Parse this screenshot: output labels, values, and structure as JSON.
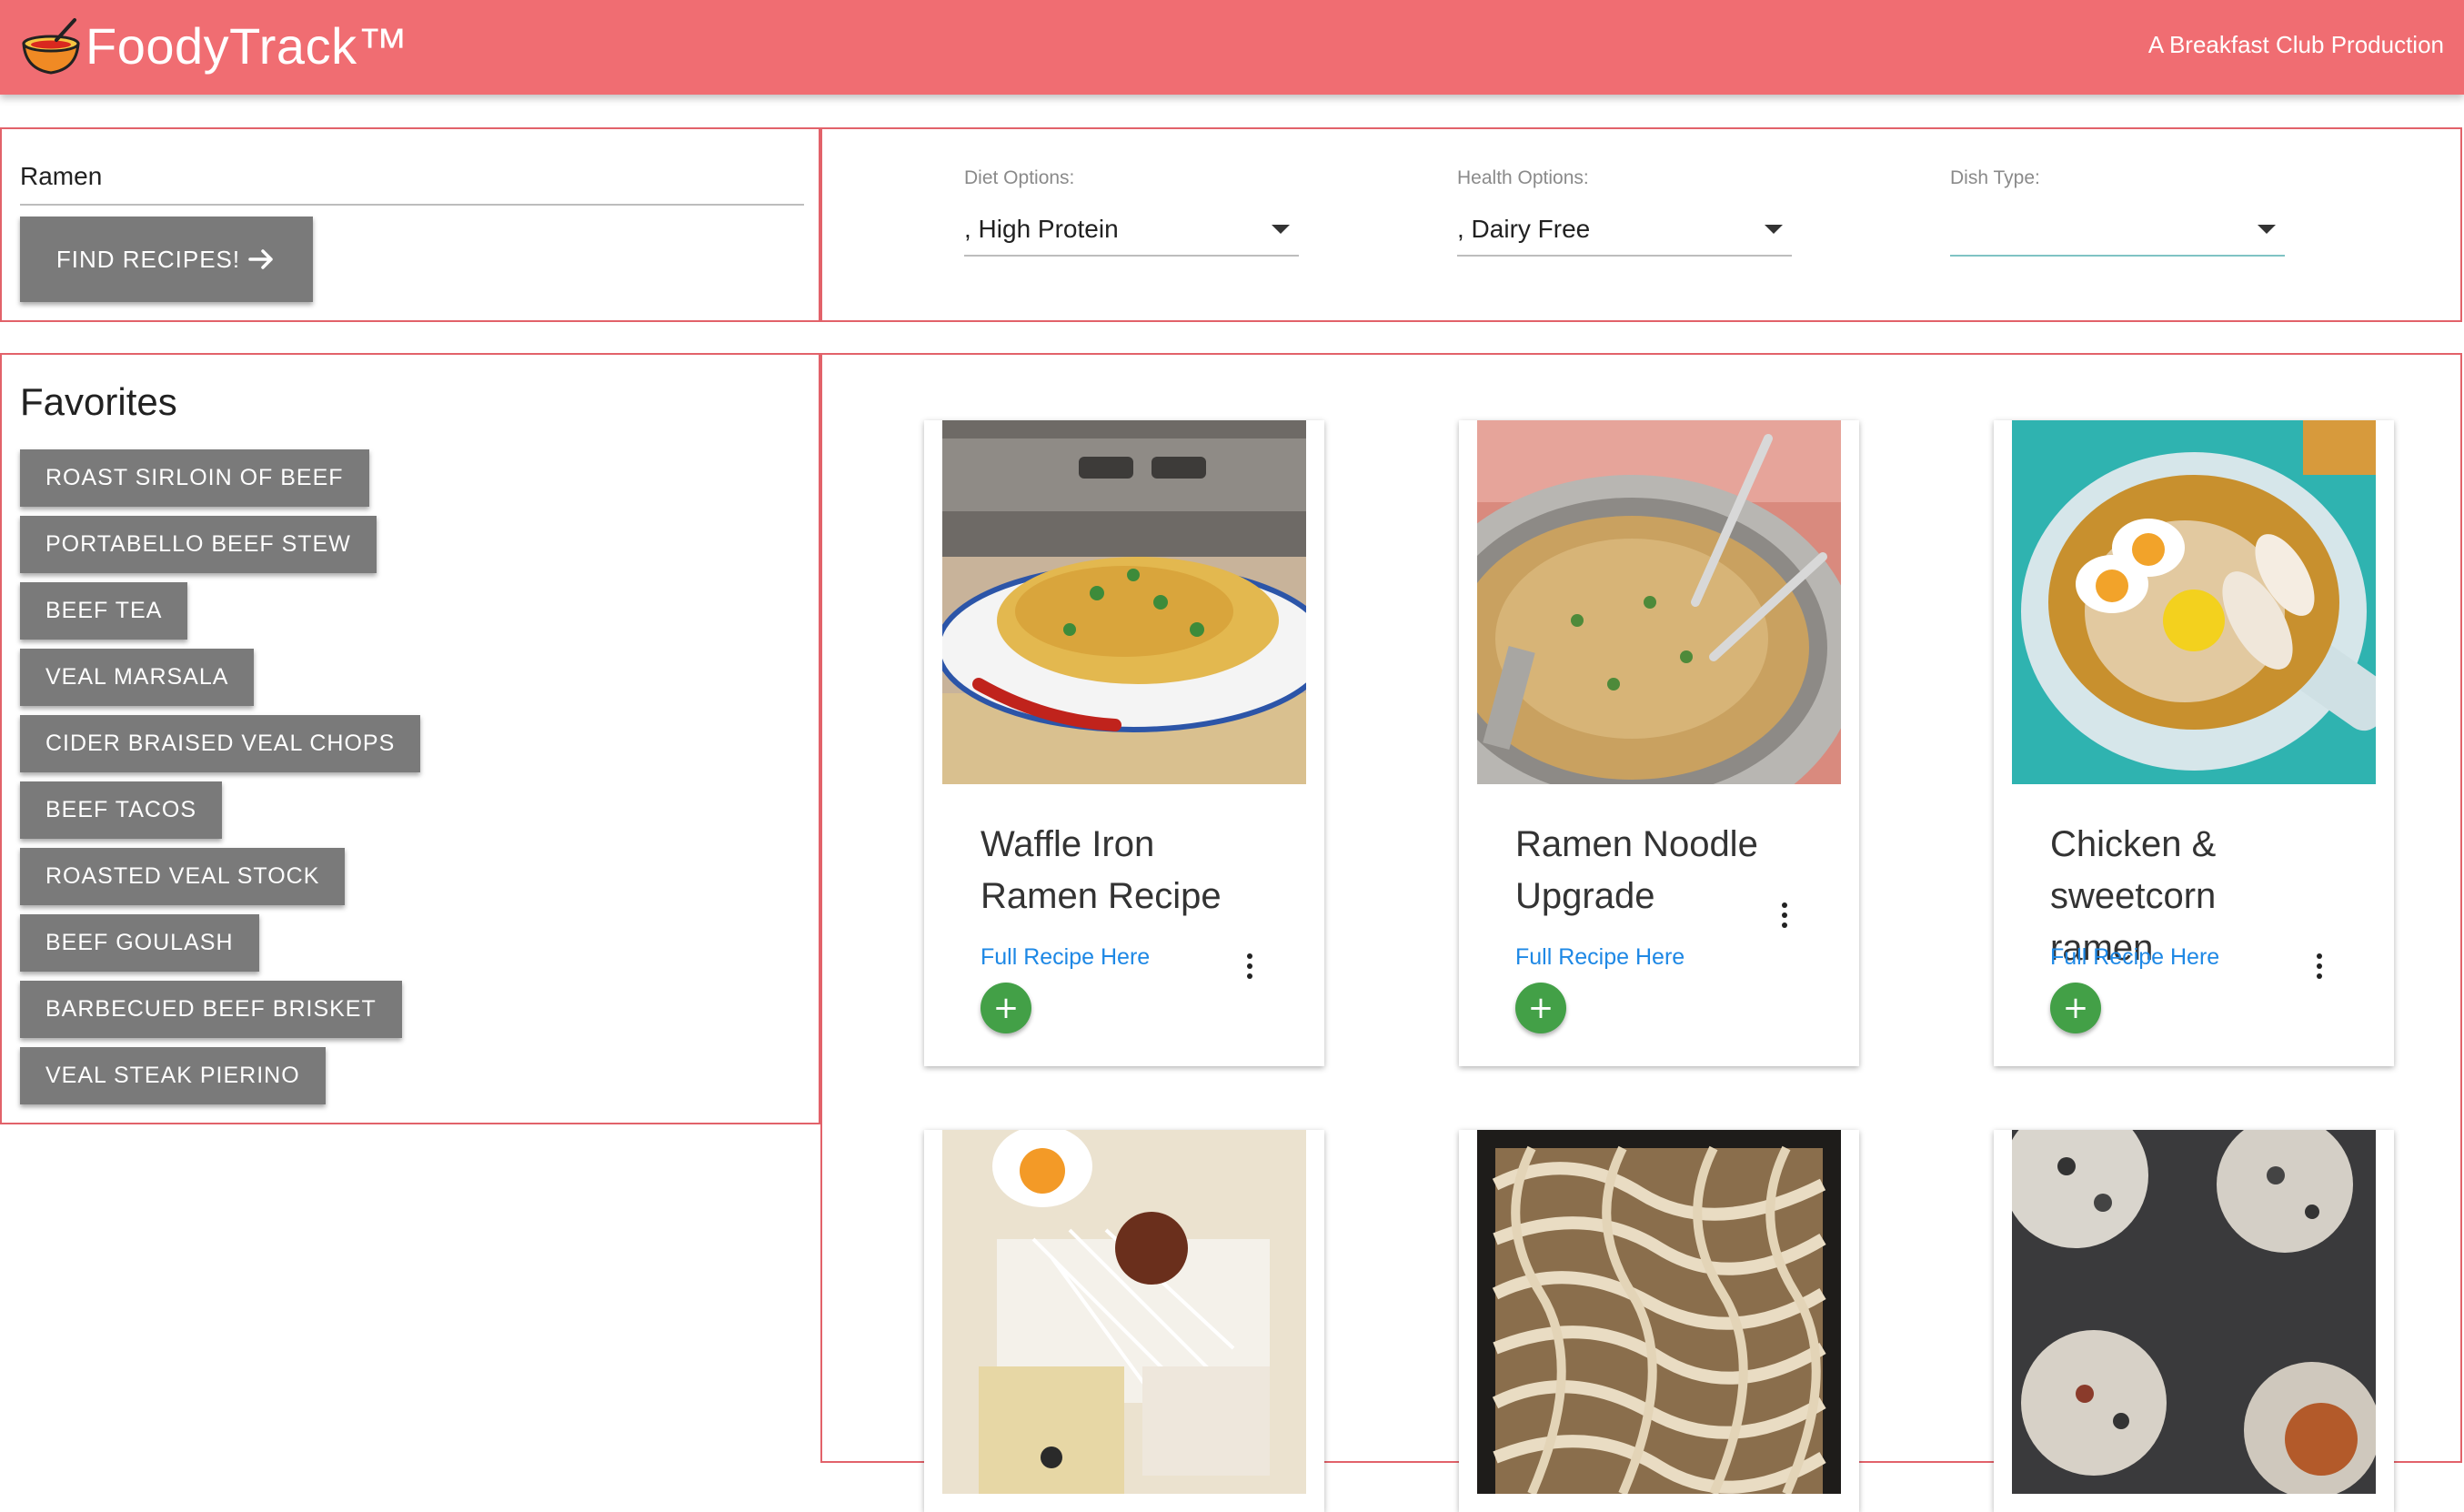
{
  "header": {
    "brand": "FoodyTrack™",
    "tagline": "A Breakfast Club Production",
    "logo_icon": "soup-bowl-icon",
    "background": "#f06d72"
  },
  "search": {
    "value": "Ramen",
    "button_label": "FIND RECIPES!",
    "button_icon": "arrow-right-icon"
  },
  "filters": [
    {
      "label": "Diet Options:",
      "value": ", High Protein"
    },
    {
      "label": "Health Options:",
      "value": ", Dairy Free"
    },
    {
      "label": "Dish Type:",
      "value": ""
    }
  ],
  "favorites": {
    "title": "Favorites",
    "items": [
      "ROAST SIRLOIN OF BEEF",
      "PORTABELLO BEEF STEW",
      "BEEF TEA",
      "VEAL MARSALA",
      "CIDER BRAISED VEAL CHOPS",
      "BEEF TACOS",
      "ROASTED VEAL STOCK",
      "BEEF GOULASH",
      "BARBECUED BEEF BRISKET",
      "VEAL STEAK PIERINO"
    ]
  },
  "recipes": [
    {
      "title": "Waffle Iron Ramen Recipe",
      "link": "Full Recipe Here",
      "add": "+"
    },
    {
      "title": "Ramen Noodle Upgrade",
      "link": "Full Recipe Here",
      "add": "+"
    },
    {
      "title": "Chicken & sweetcorn ramen",
      "link": "Full Recipe Here",
      "add": "+"
    },
    {
      "title": "",
      "link": "",
      "add": ""
    },
    {
      "title": "",
      "link": "",
      "add": ""
    },
    {
      "title": "",
      "link": "",
      "add": ""
    }
  ],
  "colors": {
    "accent": "#f06d72",
    "panel_border": "#e2626a",
    "button_grey": "#7a7a7a",
    "link_blue": "#1e88e5",
    "add_green": "#43a047"
  }
}
